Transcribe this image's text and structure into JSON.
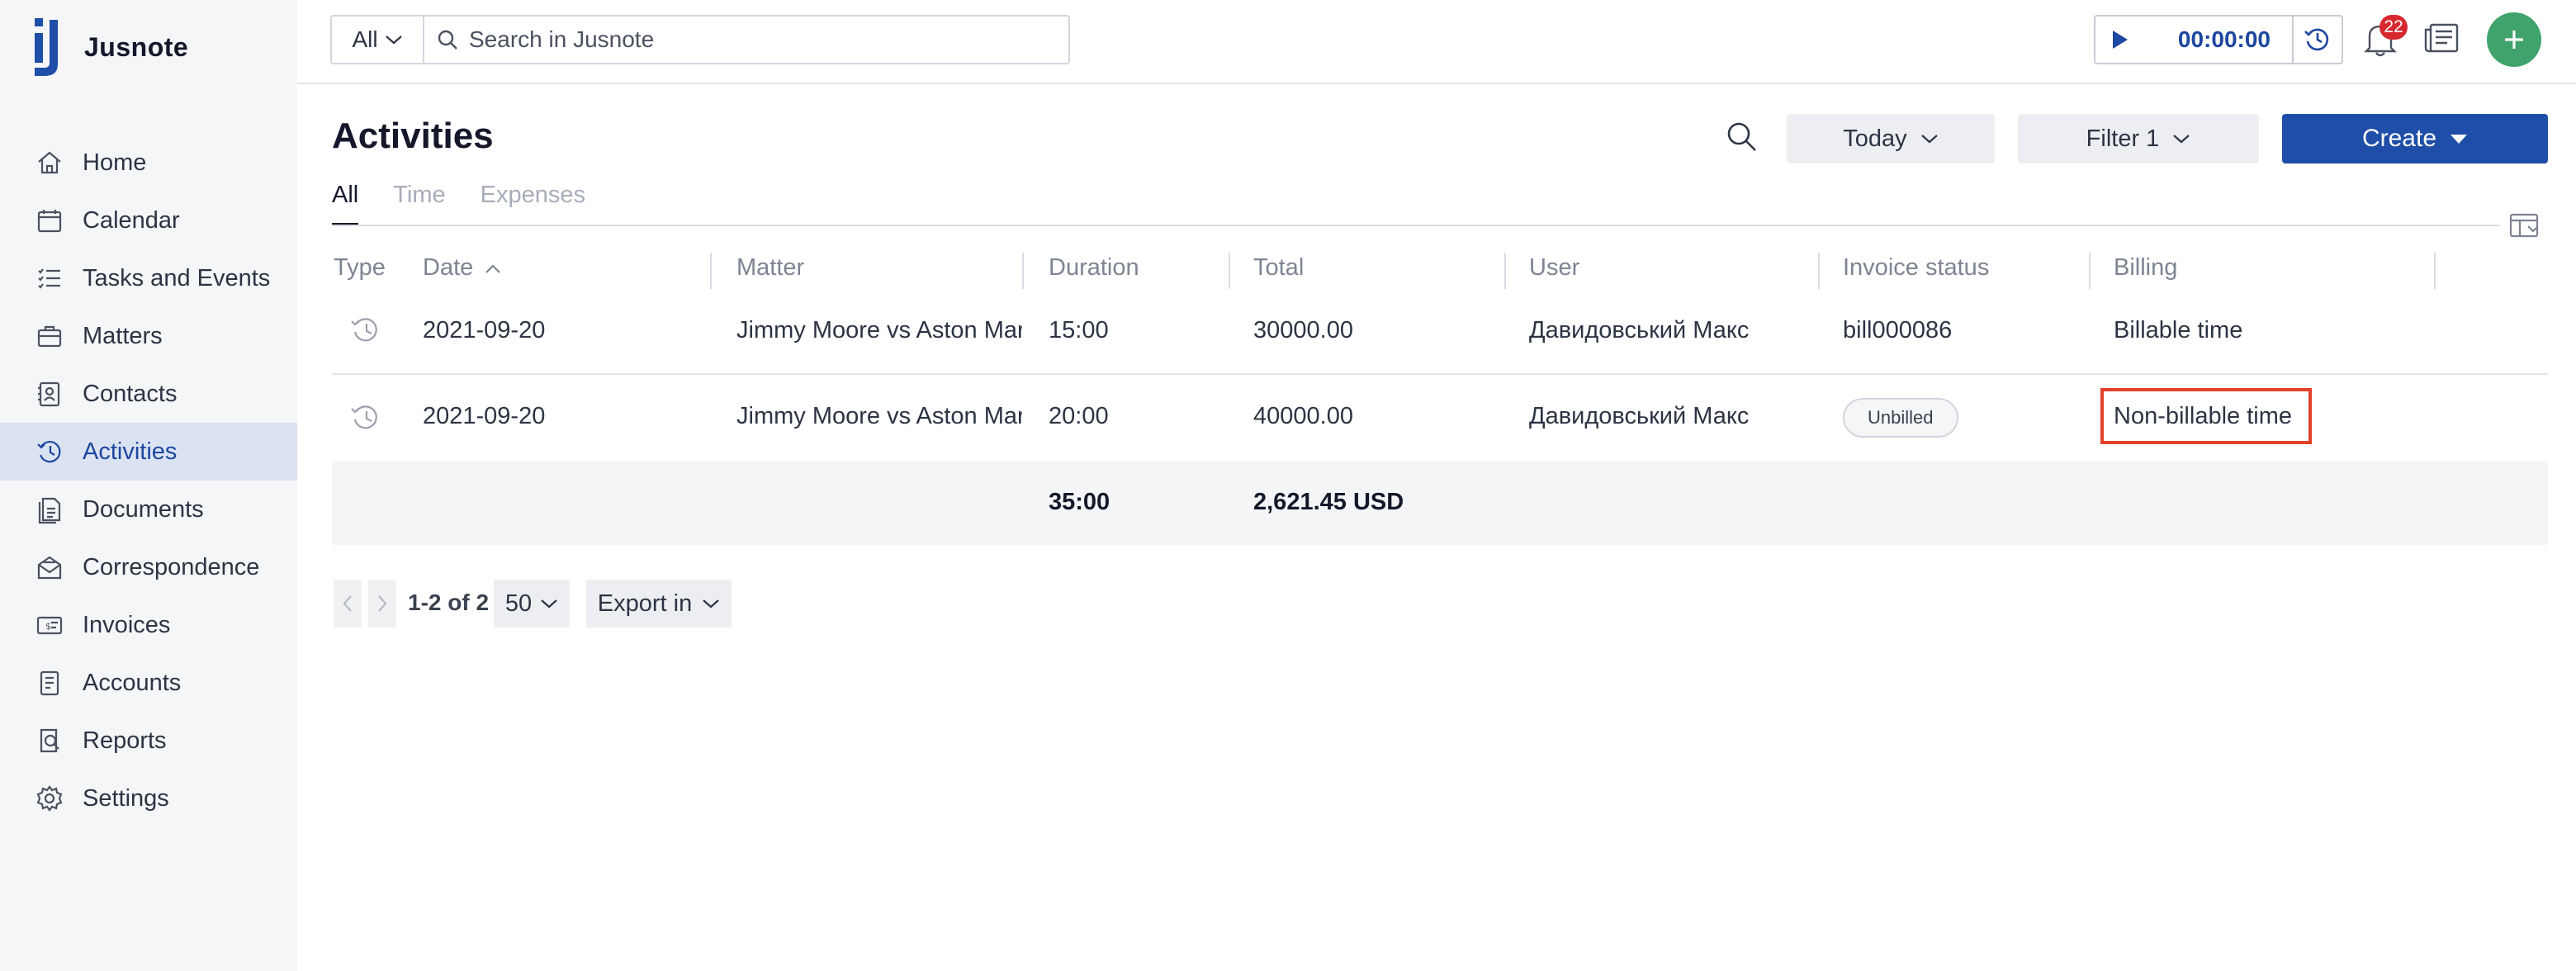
{
  "app": {
    "name": "Jusnote"
  },
  "sidebar": {
    "items": [
      {
        "label": "Home",
        "icon": "home-icon"
      },
      {
        "label": "Calendar",
        "icon": "calendar-icon"
      },
      {
        "label": "Tasks and Events",
        "icon": "tasks-icon"
      },
      {
        "label": "Matters",
        "icon": "briefcase-icon"
      },
      {
        "label": "Contacts",
        "icon": "contacts-icon"
      },
      {
        "label": "Activities",
        "icon": "activities-icon",
        "active": true
      },
      {
        "label": "Documents",
        "icon": "documents-icon"
      },
      {
        "label": "Correspondence",
        "icon": "correspondence-icon"
      },
      {
        "label": "Invoices",
        "icon": "invoice-icon"
      },
      {
        "label": "Accounts",
        "icon": "accounts-icon"
      },
      {
        "label": "Reports",
        "icon": "reports-icon"
      },
      {
        "label": "Settings",
        "icon": "gear-icon"
      }
    ]
  },
  "topbar": {
    "search_scope": "All",
    "search_placeholder": "Search in Jusnote",
    "timer_value": "00:00:00",
    "notifications_count": "22"
  },
  "page": {
    "title": "Activities",
    "period_label": "Today",
    "filter_label": "Filter 1",
    "create_label": "Create"
  },
  "tabs": [
    "All",
    "Time",
    "Expenses"
  ],
  "table": {
    "headers": {
      "type": "Type",
      "date": "Date",
      "matter": "Matter",
      "duration": "Duration",
      "total": "Total",
      "user": "User",
      "invoice_status": "Invoice status",
      "billing": "Billing"
    },
    "rows": [
      {
        "date": "2021-09-20",
        "matter": "Jimmy Moore vs Aston Martin",
        "duration": "15:00",
        "total": "30000.00",
        "user": "Давидовський Макс",
        "invoice_status": "bill000086",
        "billing": "Billable time"
      },
      {
        "date": "2021-09-20",
        "matter": "Jimmy Moore vs Aston Martin",
        "duration": "20:00",
        "total": "40000.00",
        "user": "Давидовський Макс",
        "invoice_status": "Unbilled",
        "billing": "Non-billable time"
      }
    ],
    "totals": {
      "duration": "35:00",
      "total": "2,621.45 USD"
    }
  },
  "pagination": {
    "range": "1-2 of 2",
    "page_size": "50",
    "export_label": "Export in"
  },
  "colors": {
    "accent": "#1f4ea8",
    "active_nav_bg": "#dbe3f2",
    "add_button": "#3fa36b",
    "badge": "#d7282f",
    "highlight": "#e2412b"
  }
}
